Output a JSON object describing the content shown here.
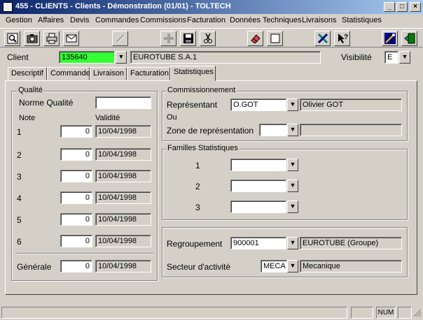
{
  "window": {
    "title": "455 - CLIENTS - Clients - Démonstration (01/01) - TOLTECH"
  },
  "menu": [
    "Gestion",
    "Affaires",
    "Devis",
    "Commandes",
    "Commissions",
    "Facturation",
    "Données Techniques",
    "Livraisons",
    "Statistiques"
  ],
  "toolbar_icons": [
    "search-icon",
    "camera-icon",
    "printer-icon",
    "mail-icon",
    "edit-disabled-icon",
    "add-disabled-icon",
    "save-icon",
    "cut-icon",
    "eraser-icon",
    "new-page-icon",
    "tools-icon",
    "help-icon",
    "wizard-icon",
    "exit-icon"
  ],
  "header": {
    "client_label": "Client",
    "client_code": "135640",
    "client_name": "EUROTUBE S.A.1",
    "visibility_label": "Visibilité",
    "visibility_value": "E"
  },
  "tabs": [
    "Descriptif",
    "Commande",
    "Livraison",
    "Facturation",
    "Statistiques"
  ],
  "active_tab": "Statistiques",
  "quality": {
    "title": "Qualité",
    "norme_label": "Norme Qualité",
    "norme_value": "",
    "note_header": "Note",
    "validity_header": "Validité",
    "rows": [
      {
        "label": "1",
        "value": "0",
        "date": "10/04/1998"
      },
      {
        "label": "2",
        "value": "0",
        "date": "10/04/1998"
      },
      {
        "label": "3",
        "value": "0",
        "date": "10/04/1998"
      },
      {
        "label": "4",
        "value": "0",
        "date": "10/04/1998"
      },
      {
        "label": "5",
        "value": "0",
        "date": "10/04/1998"
      },
      {
        "label": "6",
        "value": "0",
        "date": "10/04/1998"
      }
    ],
    "general": {
      "label": "Générale",
      "value": "0",
      "date": "10/04/1998"
    }
  },
  "commission": {
    "title": "Commissionnement",
    "rep_label": "Représentant",
    "rep_code": "O.GOT",
    "rep_name": "Olivier GOT",
    "or_label": "Ou",
    "zone_label": "Zone de représentation",
    "zone_code": "",
    "zone_name": ""
  },
  "families": {
    "title": "Familles Statistiques",
    "rows": [
      {
        "label": "1",
        "value": ""
      },
      {
        "label": "2",
        "value": ""
      },
      {
        "label": "3",
        "value": ""
      }
    ]
  },
  "grouping": {
    "regroupement_label": "Regroupement",
    "regroupement_code": "900001",
    "regroupement_name": "EUROTUBE (Groupe)",
    "sector_label": "Secteur d'activité",
    "sector_code": "MECA",
    "sector_name": "Mecanique"
  },
  "status": {
    "panel1": "",
    "panel2": "",
    "num": "NUM"
  }
}
